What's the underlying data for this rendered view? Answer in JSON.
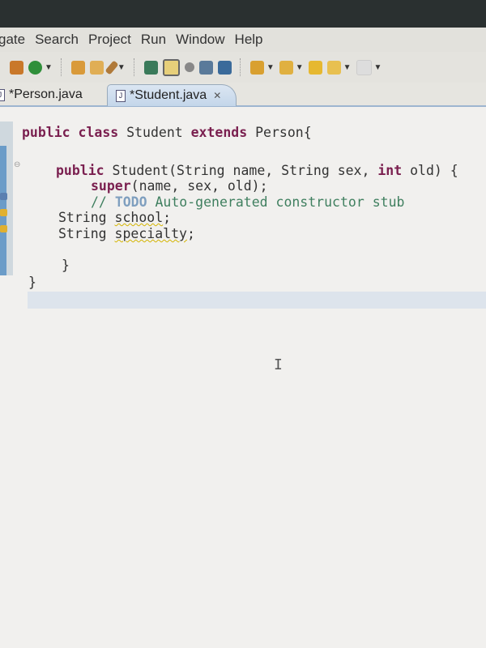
{
  "menubar": {
    "items": [
      "gate",
      "Search",
      "Project",
      "Run",
      "Window",
      "Help"
    ]
  },
  "toolbar": {
    "icons": [
      "new-package-icon",
      "new-class-icon",
      "open-type-icon",
      "open-resource-icon",
      "search-icon",
      "run-icon",
      "toggle-mark-occurrences-icon",
      "debug-icon",
      "show-whitespace-icon",
      "paragraph-icon",
      "next-annotation-icon",
      "previous-annotation-icon",
      "last-edit-icon",
      "back-icon",
      "forward-icon"
    ]
  },
  "tabs": [
    {
      "label": "*Person.java",
      "active": false
    },
    {
      "label": "*Student.java",
      "active": true,
      "close": "✕"
    }
  ],
  "code": {
    "l1": {
      "k1": "public",
      "k2": "class",
      "t1": " Student ",
      "k3": "extends",
      "t2": " Person{"
    },
    "l3": {
      "k1": "public",
      "t1": " Student(String name, String sex, ",
      "k2": "int",
      "t2": " old) {"
    },
    "l4": {
      "k1": "super",
      "t1": "(name, sex, old);"
    },
    "l5": {
      "c1": "// ",
      "todo": "TODO",
      "c2": " Auto-generated constructor stub"
    },
    "l6": {
      "t1": "String ",
      "w": "school",
      "t2": ";"
    },
    "l7": {
      "t1": "String ",
      "w": "specialty",
      "t2": ";"
    },
    "l9": "}",
    "l10": "}"
  },
  "colors": {
    "keyword": "#7a1f4f",
    "comment": "#3f7f5f",
    "todo": "#7f9fbf",
    "warning": "#d4b400",
    "current_line": "#dde4ec"
  }
}
